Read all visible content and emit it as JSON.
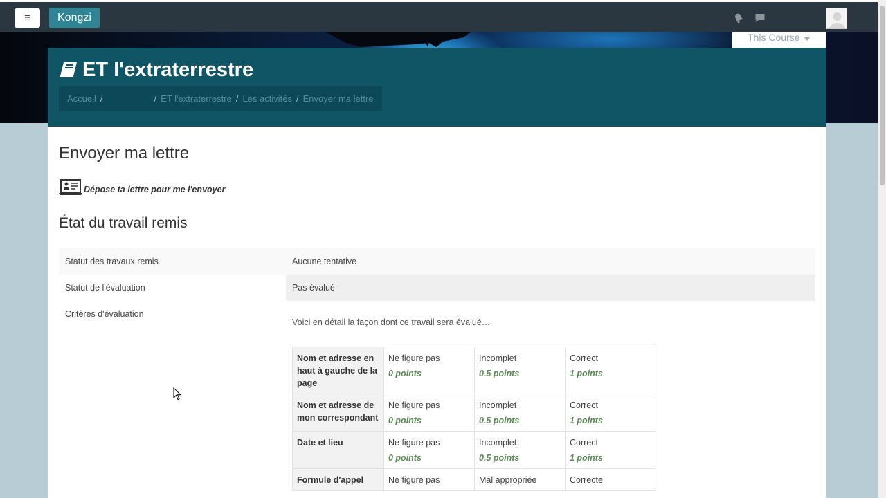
{
  "navbar": {
    "menu_icon": "≡",
    "brand": "Kongzi",
    "icons": [
      "bell-icon",
      "chat-icon",
      "avatar-icon"
    ]
  },
  "course_menu": {
    "label": "This Course"
  },
  "header": {
    "title": "ET l'extraterrestre",
    "breadcrumb": [
      "Accueil",
      "",
      "ET l'extraterrestre",
      "Les activités",
      "Envoyer ma lettre"
    ]
  },
  "activity": {
    "title": "Envoyer ma lettre",
    "intro": "Dépose ta lettre pour me l'envoyer"
  },
  "submission_status": {
    "heading": "État du travail remis",
    "rows": [
      {
        "label": "Statut des travaux remis",
        "value": "Aucune tentative"
      },
      {
        "label": "Statut de l'évaluation",
        "value": "Pas évalué"
      },
      {
        "label": "Critères d'évaluation",
        "value": "Voici en détail la façon dont ce travail sera évalué…"
      }
    ]
  },
  "rubric": {
    "criteria": [
      {
        "name": "Nom et adresse en haut à gauche de la page",
        "levels": [
          {
            "def": "Ne figure pas",
            "score": "0  points"
          },
          {
            "def": "Incomplet",
            "score": "0.5  points"
          },
          {
            "def": "Correct",
            "score": "1  points"
          }
        ]
      },
      {
        "name": "Nom et adresse de mon correspondant",
        "levels": [
          {
            "def": "Ne figure pas",
            "score": "0  points"
          },
          {
            "def": "Incomplet",
            "score": "0.5  points"
          },
          {
            "def": "Correct",
            "score": "1  points"
          }
        ]
      },
      {
        "name": "Date et lieu",
        "levels": [
          {
            "def": "Ne figure pas",
            "score": "0  points"
          },
          {
            "def": "Incomplet",
            "score": "0.5  points"
          },
          {
            "def": "Correct",
            "score": "1  points"
          }
        ]
      },
      {
        "name": "Formule d'appel",
        "levels": [
          {
            "def": "Ne figure pas",
            "score": ""
          },
          {
            "def": "Mal appropriée",
            "score": ""
          },
          {
            "def": "Correcte",
            "score": ""
          }
        ]
      }
    ]
  },
  "colors": {
    "navbar": "#2b3740",
    "brand": "#2f8594",
    "header": "#105566",
    "score": "#5b8a55"
  }
}
